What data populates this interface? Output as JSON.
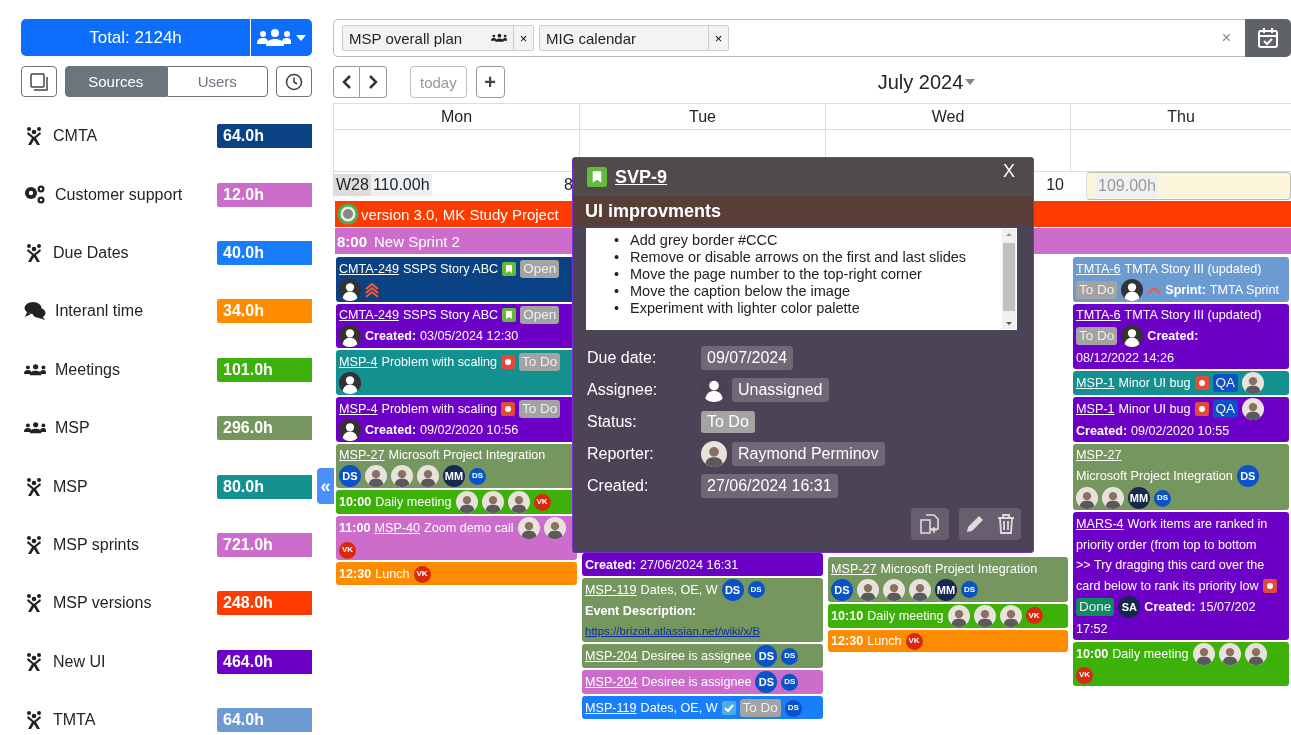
{
  "toolbar": {
    "total": "Total: 2124h"
  },
  "view_toggle": [
    {
      "label": "Sources",
      "selected": true
    },
    {
      "label": "Users",
      "selected": false
    }
  ],
  "sources": [
    {
      "kind": "figure",
      "name": "CMTA",
      "hours": "64.0h",
      "color": "#0a4283"
    },
    {
      "kind": "gears",
      "name": "Customer support",
      "hours": "12.0h",
      "color": "#cc6dcc"
    },
    {
      "kind": "figure",
      "name": "Due Dates",
      "hours": "40.0h",
      "color": "#1a7efb"
    },
    {
      "kind": "chat",
      "name": "Interanl time",
      "hours": "34.0h",
      "color": "#ff8c00"
    },
    {
      "kind": "group",
      "name": "Meetings",
      "hours": "101.0h",
      "color": "#3db00a"
    },
    {
      "kind": "group",
      "name": "MSP",
      "hours": "296.0h",
      "color": "#76965f"
    },
    {
      "kind": "figure",
      "name": "MSP",
      "hours": "80.0h",
      "color": "#149090"
    },
    {
      "kind": "figure",
      "name": "MSP sprints",
      "hours": "721.0h",
      "color": "#cc6dcc"
    },
    {
      "kind": "figure",
      "name": "MSP versions",
      "hours": "248.0h",
      "color": "#ff3c00"
    },
    {
      "kind": "figure",
      "name": "New UI",
      "hours": "464.0h",
      "color": "#6d00c7"
    },
    {
      "kind": "figure",
      "name": "TMTA",
      "hours": "64.0h",
      "color": "#6c9bd2"
    }
  ],
  "collapse": "«",
  "calendars": [
    {
      "label": "MSP overall plan",
      "shared": true,
      "remove": "×"
    },
    {
      "label": "MIG calendar",
      "shared": false,
      "remove": "×"
    }
  ],
  "clear": "×",
  "nav": {
    "today": "today",
    "add": "+",
    "title": "July 2024"
  },
  "days": [
    {
      "name": "Mon",
      "week": "W28",
      "hours": "110.00h",
      "number": "8",
      "today": false
    },
    {
      "name": "Tue",
      "today": false
    },
    {
      "name": "Wed",
      "number": "10",
      "today": false
    },
    {
      "name": "Thu",
      "hours": "109.00h",
      "today": true
    }
  ],
  "banners": [
    {
      "kind": "version",
      "text": "version 3.0, MK Study Project",
      "color": "#ff3c00"
    },
    {
      "kind": "sprint",
      "time": "8:00",
      "text": "New Sprint 2",
      "color": "#cc6dcc"
    }
  ],
  "columns": [
    {
      "cards": [
        {
          "color": "#0a4283",
          "parts": [
            {
              "kind": "key",
              "text": "CMTA-249"
            },
            {
              "kind": "text",
              "text": "SSPS Story ABC"
            },
            {
              "kind": "story"
            },
            {
              "kind": "status",
              "text": "Open",
              "color": "#a3a3a3"
            },
            {
              "kind": "user"
            },
            {
              "kind": "highest"
            }
          ]
        },
        {
          "color": "#6d00c7",
          "parts": [
            {
              "kind": "key",
              "text": "CMTA-249"
            },
            {
              "kind": "text",
              "text": "SSPS Story ABC"
            },
            {
              "kind": "story"
            },
            {
              "kind": "status",
              "text": "Open",
              "color": "#a3a3a3"
            },
            {
              "kind": "user"
            },
            {
              "kind": "bold",
              "text": "Created:"
            },
            {
              "kind": "text",
              "text": "03/05/2024 12:30"
            }
          ]
        },
        {
          "color": "#149090",
          "parts": [
            {
              "kind": "key",
              "text": "MSP-4"
            },
            {
              "kind": "text",
              "text": "Problem with scaling"
            },
            {
              "kind": "bug"
            },
            {
              "kind": "status",
              "text": "To Do",
              "color": "#a3a3a3"
            },
            {
              "kind": "user"
            }
          ]
        },
        {
          "color": "#6d00c7",
          "parts": [
            {
              "kind": "key",
              "text": "MSP-4"
            },
            {
              "kind": "text",
              "text": "Problem with scaling"
            },
            {
              "kind": "bug"
            },
            {
              "kind": "status",
              "text": "To Do",
              "color": "#a3a3a3"
            },
            {
              "kind": "user"
            },
            {
              "kind": "bold",
              "text": "Created:"
            },
            {
              "kind": "text",
              "text": "09/02/2020 10:56"
            }
          ]
        },
        {
          "color": "#76965f",
          "parts": [
            {
              "kind": "key",
              "text": "MSP-27"
            },
            {
              "kind": "text",
              "text": "Microsoft Project Integration"
            },
            {
              "kind": "initials",
              "text": "DS",
              "color": "#0a52c7"
            },
            {
              "kind": "photo"
            },
            {
              "kind": "photo"
            },
            {
              "kind": "photo"
            },
            {
              "kind": "initials",
              "text": "MM",
              "color": "#16284f"
            },
            {
              "kind": "mini",
              "text": "DS",
              "color": "#0a52c7"
            }
          ]
        },
        {
          "color": "#3db00a",
          "parts": [
            {
              "kind": "time",
              "text": "10:00"
            },
            {
              "kind": "text",
              "text": "Daily meeting"
            },
            {
              "kind": "photo"
            },
            {
              "kind": "photo"
            },
            {
              "kind": "photo"
            },
            {
              "kind": "mini",
              "text": "VK",
              "color": "#d8290c"
            }
          ]
        },
        {
          "color": "#cc6dcc",
          "parts": [
            {
              "kind": "time",
              "text": "11:00"
            },
            {
              "kind": "key",
              "text": "MSP-40"
            },
            {
              "kind": "text",
              "text": "Zoom demo call"
            },
            {
              "kind": "photo"
            },
            {
              "kind": "photo"
            },
            {
              "kind": "mini",
              "text": "VK",
              "color": "#d8290c"
            }
          ]
        },
        {
          "color": "#ff8c00",
          "parts": [
            {
              "kind": "time",
              "text": "12:30"
            },
            {
              "kind": "text",
              "text": "Lunch"
            },
            {
              "kind": "mini",
              "text": "VK",
              "color": "#d8290c"
            }
          ]
        }
      ]
    },
    {
      "cards": [
        {
          "color": "#6d00c7",
          "parts": [
            {
              "kind": "bold",
              "text": "Created:"
            },
            {
              "kind": "text",
              "text": "27/06/2024 16:31"
            }
          ]
        },
        {
          "color": "#76965f",
          "parts": [
            {
              "kind": "key",
              "text": "MSP-119"
            },
            {
              "kind": "text",
              "text": "Dates, OE, W"
            },
            {
              "kind": "initials",
              "text": "DS",
              "color": "#0a52c7"
            },
            {
              "kind": "mini",
              "text": "DS",
              "color": "#0a52c7"
            },
            {
              "kind": "bold",
              "text": "Event Description:"
            },
            {
              "kind": "link",
              "text": "https://brizoit.atlassian.net/wiki/x/B"
            }
          ]
        },
        {
          "color": "#76965f",
          "parts": [
            {
              "kind": "key",
              "text": "MSP-204"
            },
            {
              "kind": "text",
              "text": "Desiree is assignee"
            },
            {
              "kind": "initials",
              "text": "DS",
              "color": "#0a52c7"
            },
            {
              "kind": "mini",
              "text": "DS",
              "color": "#0a52c7"
            }
          ]
        },
        {
          "color": "#cc6dcc",
          "parts": [
            {
              "kind": "key",
              "text": "MSP-204"
            },
            {
              "kind": "text",
              "text": "Desiree is assignee"
            },
            {
              "kind": "initials",
              "text": "DS",
              "color": "#0a52c7"
            },
            {
              "kind": "mini",
              "text": "DS",
              "color": "#0a52c7"
            }
          ]
        },
        {
          "color": "#1a7efb",
          "parts": [
            {
              "kind": "key",
              "text": "MSP-119"
            },
            {
              "kind": "text",
              "text": "Dates, OE, W"
            },
            {
              "kind": "check"
            },
            {
              "kind": "status",
              "text": "To Do",
              "color": "#a3a3a3"
            },
            {
              "kind": "mini",
              "text": "DS",
              "color": "#0a52c7"
            }
          ]
        }
      ]
    },
    {
      "cards": [
        {
          "color": "#76965f",
          "parts": [
            {
              "kind": "key",
              "text": "MSP-27"
            },
            {
              "kind": "text",
              "text": "Microsoft Project Integration"
            },
            {
              "kind": "initials",
              "text": "DS",
              "color": "#0a52c7"
            },
            {
              "kind": "photo"
            },
            {
              "kind": "photo"
            },
            {
              "kind": "photo"
            },
            {
              "kind": "initials",
              "text": "MM",
              "color": "#16284f"
            },
            {
              "kind": "mini",
              "text": "DS",
              "color": "#0a52c7"
            }
          ]
        },
        {
          "color": "#3db00a",
          "parts": [
            {
              "kind": "time",
              "text": "10:10"
            },
            {
              "kind": "text",
              "text": "Daily meeting"
            },
            {
              "kind": "photo"
            },
            {
              "kind": "photo"
            },
            {
              "kind": "photo"
            },
            {
              "kind": "mini",
              "text": "VK",
              "color": "#d8290c"
            }
          ]
        },
        {
          "color": "#ff8c00",
          "parts": [
            {
              "kind": "time",
              "text": "12:30"
            },
            {
              "kind": "text",
              "text": "Lunch"
            },
            {
              "kind": "mini",
              "text": "VK",
              "color": "#d8290c"
            }
          ]
        }
      ]
    },
    {
      "cards": [
        {
          "color": "#6c9bd2",
          "parts": [
            {
              "kind": "key",
              "text": "TMTA-6"
            },
            {
              "kind": "text",
              "text": "TMTA Story III (updated)"
            },
            {
              "kind": "status",
              "text": "To Do",
              "color": "#a3a3a3"
            },
            {
              "kind": "user"
            },
            {
              "kind": "high"
            },
            {
              "kind": "bold",
              "text": "Sprint:"
            },
            {
              "kind": "text",
              "text": "TMTA Sprint"
            }
          ]
        },
        {
          "color": "#6d00c7",
          "parts": [
            {
              "kind": "key",
              "text": "TMTA-6"
            },
            {
              "kind": "text",
              "text": "TMTA Story III (updated)"
            },
            {
              "kind": "status",
              "text": "To Do",
              "color": "#a3a3a3"
            },
            {
              "kind": "user"
            },
            {
              "kind": "bold",
              "text": "Created:"
            },
            {
              "kind": "text",
              "text": "08/12/2022 14:26"
            }
          ]
        },
        {
          "color": "#149090",
          "parts": [
            {
              "kind": "key",
              "text": "MSP-1"
            },
            {
              "kind": "text",
              "text": "Minor UI bug"
            },
            {
              "kind": "bug"
            },
            {
              "kind": "status",
              "text": "QA",
              "color": "#0a52c7"
            },
            {
              "kind": "photo"
            }
          ]
        },
        {
          "color": "#6d00c7",
          "parts": [
            {
              "kind": "key",
              "text": "MSP-1"
            },
            {
              "kind": "text",
              "text": "Minor UI bug"
            },
            {
              "kind": "bug"
            },
            {
              "kind": "status",
              "text": "QA",
              "color": "#0a52c7"
            },
            {
              "kind": "photo"
            },
            {
              "kind": "bold",
              "text": "Created:"
            },
            {
              "kind": "text",
              "text": "09/02/2020 10:55"
            }
          ]
        },
        {
          "color": "#76965f",
          "parts": [
            {
              "kind": "key",
              "text": "MSP-27"
            },
            {
              "kind": "text",
              "text": "Microsoft Project Integration"
            },
            {
              "kind": "initials",
              "text": "DS",
              "color": "#0a52c7"
            },
            {
              "kind": "photo"
            },
            {
              "kind": "photo"
            },
            {
              "kind": "initials",
              "text": "MM",
              "color": "#16284f"
            },
            {
              "kind": "mini",
              "text": "DS",
              "color": "#0a52c7"
            }
          ]
        },
        {
          "color": "#6d00c7",
          "parts": [
            {
              "kind": "key",
              "text": "MARS-4"
            },
            {
              "kind": "text",
              "text": "Work items are ranked in"
            },
            {
              "kind": "text",
              "text": "priority order (from top to bottom"
            },
            {
              "kind": "text",
              "text": ">> Try dragging this card over the"
            },
            {
              "kind": "text",
              "text": "card below to rank its priority low"
            },
            {
              "kind": "bug"
            },
            {
              "kind": "status",
              "text": "Done",
              "color": "#0e8a5f"
            },
            {
              "kind": "initials",
              "text": "SA",
              "color": "#16284f"
            },
            {
              "kind": "bold",
              "text": "Created:"
            },
            {
              "kind": "text",
              "text": "15/07/202"
            },
            {
              "kind": "text",
              "text": "17:52"
            }
          ]
        },
        {
          "color": "#3db00a",
          "parts": [
            {
              "kind": "time",
              "text": "10:00"
            },
            {
              "kind": "text",
              "text": "Daily meeting"
            },
            {
              "kind": "photo"
            },
            {
              "kind": "photo"
            },
            {
              "kind": "photo"
            },
            {
              "kind": "mini",
              "text": "VK",
              "color": "#d8290c"
            }
          ]
        }
      ]
    }
  ],
  "popup": {
    "key": "SVP-9",
    "title": "UI improvments",
    "close": "X",
    "bullet": "•",
    "description": [
      "Add grey border #CCC",
      "Remove or disable arrows on the first and last slides",
      "Move the page number to the top-right corner",
      "Move the caption below the image",
      "Experiment with lighter color palette"
    ],
    "fields": [
      {
        "kind": "date",
        "label": "Due date:",
        "value": "09/07/2024"
      },
      {
        "kind": "blank-user",
        "label": "Assignee:",
        "value": "Unassigned"
      },
      {
        "kind": "status",
        "label": "Status:",
        "value": "To Do"
      },
      {
        "kind": "photo-user",
        "label": "Reporter:",
        "value": "Raymond Perminov"
      },
      {
        "kind": "date",
        "label": "Created:",
        "value": "27/06/2024 16:31"
      }
    ]
  }
}
